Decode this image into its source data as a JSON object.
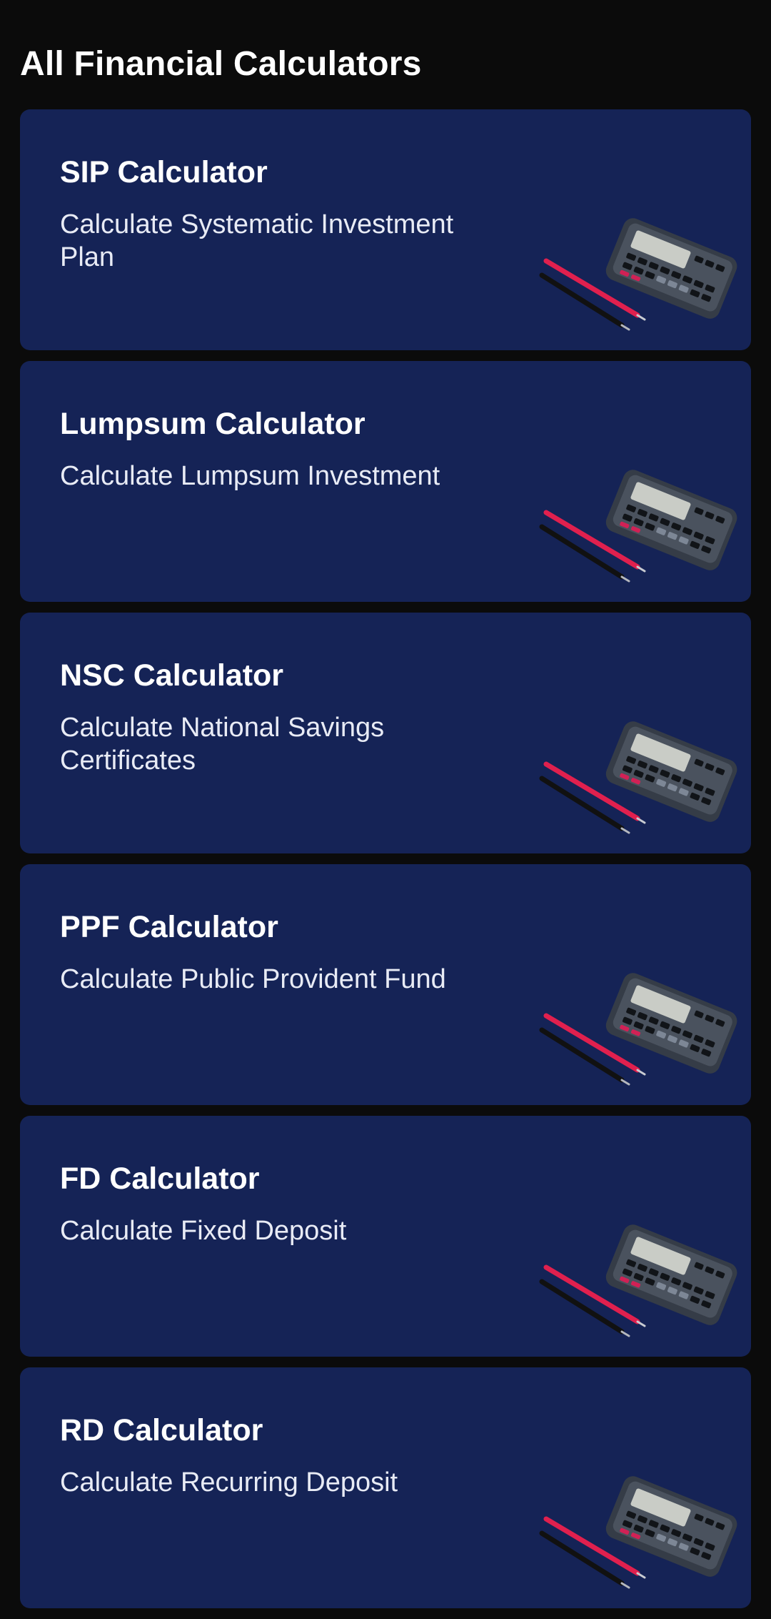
{
  "header": {
    "title": "All Financial Calculators"
  },
  "calculators": [
    {
      "title": "SIP Calculator",
      "description": "Calculate Systematic Investment Plan",
      "icon": "calculator-pens-icon"
    },
    {
      "title": "Lumpsum Calculator",
      "description": "Calculate Lumpsum Investment",
      "icon": "calculator-pens-icon"
    },
    {
      "title": "NSC Calculator",
      "description": "Calculate National Savings Certificates",
      "icon": "calculator-pens-icon"
    },
    {
      "title": "PPF Calculator",
      "description": "Calculate Public Provident Fund",
      "icon": "calculator-pens-icon"
    },
    {
      "title": "FD Calculator",
      "description": "Calculate Fixed Deposit",
      "icon": "calculator-pens-icon"
    },
    {
      "title": "RD Calculator",
      "description": "Calculate Recurring Deposit",
      "icon": "calculator-pens-icon"
    }
  ],
  "colors": {
    "background": "#0b0b0b",
    "card": "#152356",
    "pen_accent": "#e0204e"
  }
}
